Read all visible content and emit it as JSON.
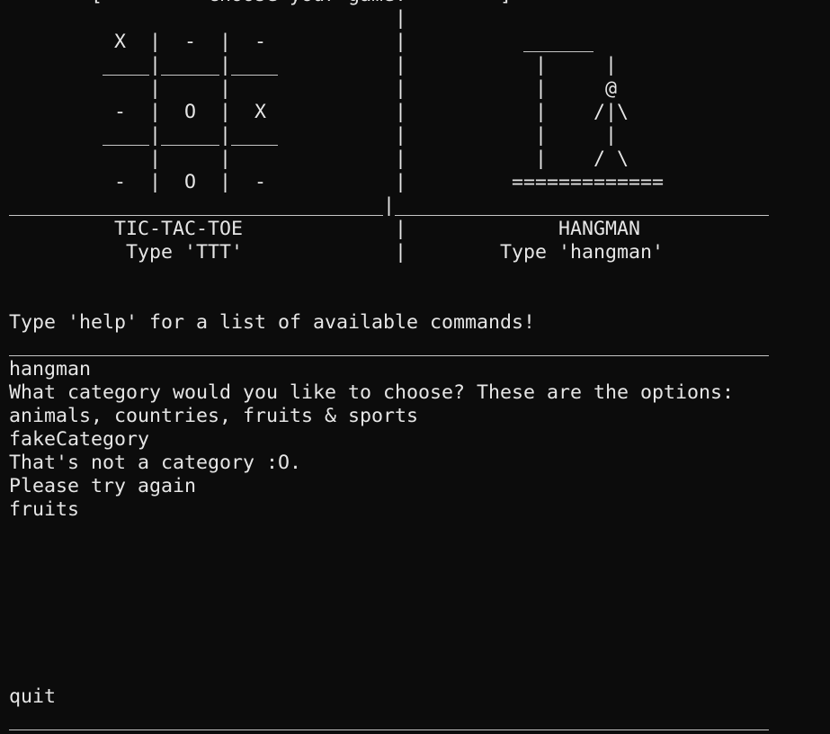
{
  "terminal": {
    "lines": [
      "       [         Choose your game!        ]",
      "                                 |",
      "         X  |  -  |  -           |          ______",
      "        ____|_____|____          |           |     |",
      "            |     |              |           |     @",
      "         -  |  O  |  X           |           |    /|\\",
      "        ____|_____|____          |           |     |",
      "            |     |              |           |    / \\",
      "         -  |  O  |  -           |         =============",
      "________________________________|________________________________",
      "         TIC-TAC-TOE             |             HANGMAN",
      "          Type 'TTT'             |        Type 'hangman'",
      "",
      "",
      "Type 'help' for a list of available commands!",
      "_________________________________________________________________",
      "hangman",
      "What category would you like to choose? These are the options:",
      "animals, countries, fruits & sports",
      "fakeCategory",
      "That's not a category :O.",
      "Please try again",
      "fruits",
      "",
      "",
      "",
      "",
      "",
      "",
      "",
      "quit",
      "_________________________________________________________________"
    ]
  }
}
